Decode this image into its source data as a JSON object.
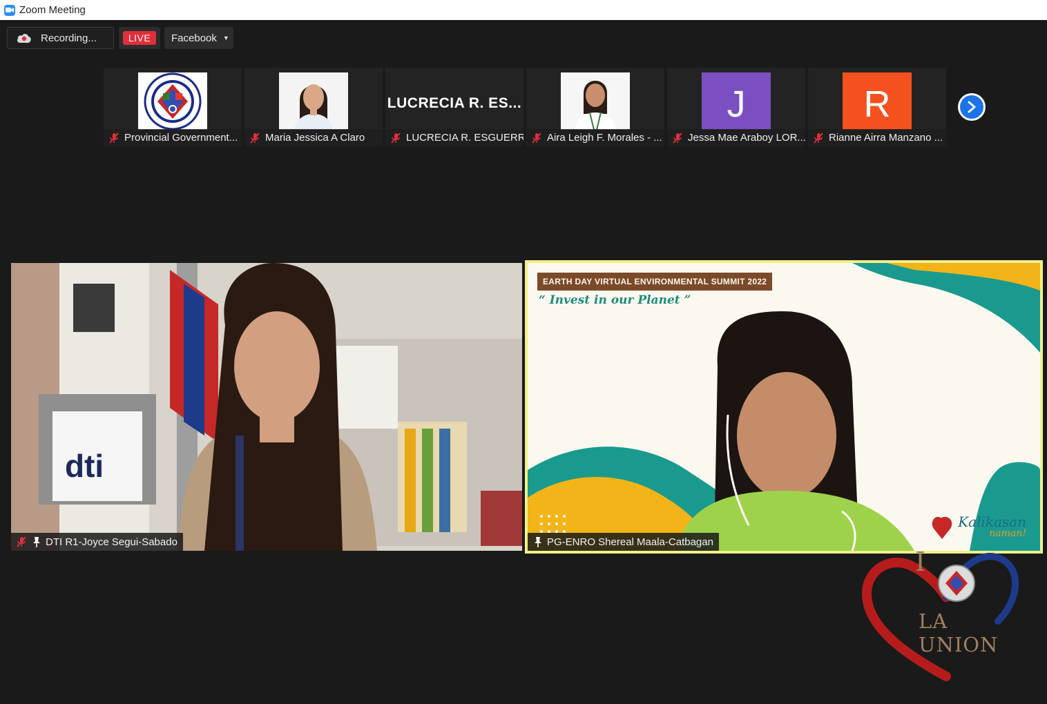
{
  "window": {
    "title": "Zoom Meeting"
  },
  "toolbar": {
    "recording_label": "Recording...",
    "live_label": "LIVE",
    "stream_target": "Facebook"
  },
  "thumbnails": [
    {
      "name": "Provincial Government...",
      "type": "logo"
    },
    {
      "name": "Maria Jessica A Claro",
      "type": "photo"
    },
    {
      "name": "LUCRECIA R. ESGUERR...",
      "type": "text",
      "big_label": "LUCRECIA R. ES..."
    },
    {
      "name": "Aira Leigh F. Morales - ...",
      "type": "photo"
    },
    {
      "name": "Jessa Mae Araboy LOR...",
      "type": "letter",
      "letter": "J",
      "color": "#7b4fc2"
    },
    {
      "name": "Rianne Airra Manzano ...",
      "type": "letter",
      "letter": "R",
      "color": "#f4511e"
    }
  ],
  "main": {
    "left": {
      "name": "DTI R1-Joyce Segui-Sabado"
    },
    "right": {
      "name": "PG-ENRO Shereal Maala-Catbagan",
      "summit_title": "EARTH DAY VIRTUAL ENVIRONMENTAL SUMMIT 2022",
      "slogan": "“ Invest in our Planet ”",
      "kalikasan": "Kalikasan",
      "kalikasan_sub": "naman!"
    }
  },
  "overlay": {
    "la_union_text": "LA UNION",
    "la_union_i": "I"
  },
  "colors": {
    "active_speaker_border": "#f0f08a",
    "live_red": "#e02f3c",
    "next_blue": "#1a73e8"
  }
}
